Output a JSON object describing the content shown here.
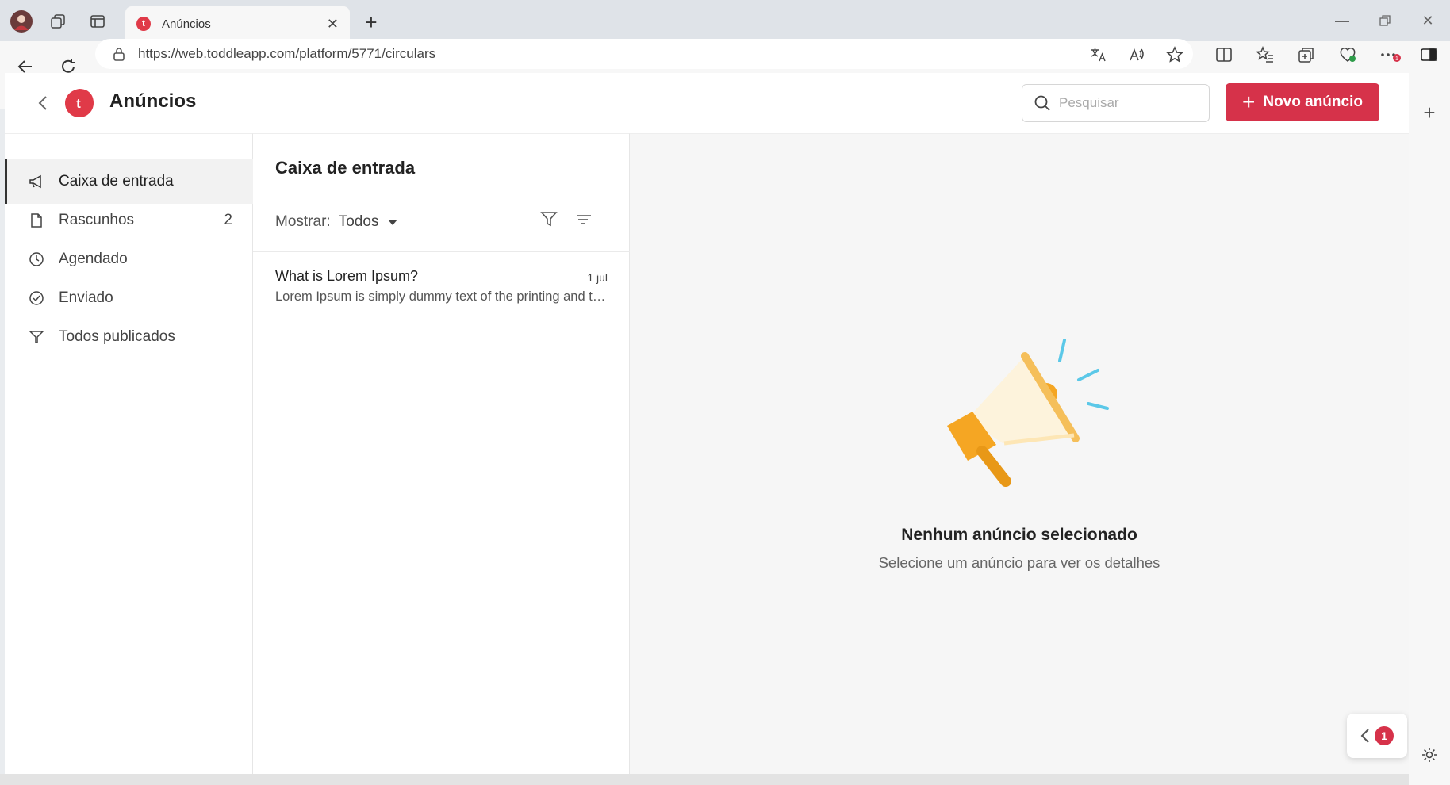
{
  "browser": {
    "tab_title": "Anúncios",
    "url": "https://web.toddleapp.com/platform/5771/circulars"
  },
  "header": {
    "title": "Anúncios",
    "logo_letter": "t",
    "search_placeholder": "Pesquisar",
    "new_button_label": "Novo anúncio"
  },
  "sidebar": {
    "items": [
      {
        "label": "Caixa de entrada",
        "icon": "megaphone-icon",
        "active": true
      },
      {
        "label": "Rascunhos",
        "icon": "document-icon",
        "count": "2"
      },
      {
        "label": "Agendado",
        "icon": "clock-icon"
      },
      {
        "label": "Enviado",
        "icon": "check-circle-icon"
      },
      {
        "label": "Todos publicados",
        "icon": "send-icon"
      }
    ]
  },
  "list": {
    "title": "Caixa de entrada",
    "show_label": "Mostrar:",
    "show_value": "Todos",
    "messages": [
      {
        "title": "What is Lorem Ipsum?",
        "date": "1 jul",
        "preview": "Lorem Ipsum is simply dummy text of the printing and typesetting industry."
      }
    ]
  },
  "detail": {
    "empty_title": "Nenhum anúncio selecionado",
    "empty_subtitle": "Selecione um anúncio para ver os detalhes"
  },
  "chat": {
    "badge": "1"
  },
  "colors": {
    "brand": "#d6324a",
    "megaphone": "#f5a623",
    "accent_lines": "#5bc8e8"
  }
}
